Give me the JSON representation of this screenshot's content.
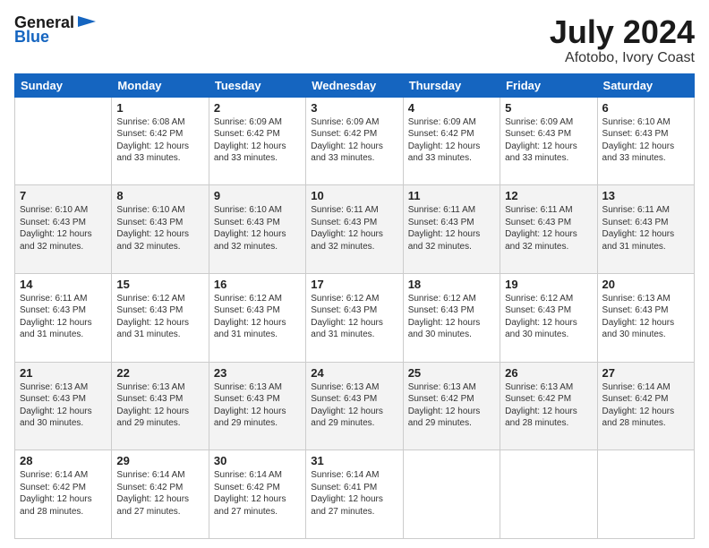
{
  "header": {
    "logo_general": "General",
    "logo_blue": "Blue",
    "month": "July 2024",
    "location": "Afotobo, Ivory Coast"
  },
  "weekdays": [
    "Sunday",
    "Monday",
    "Tuesday",
    "Wednesday",
    "Thursday",
    "Friday",
    "Saturday"
  ],
  "weeks": [
    [
      {
        "day": "",
        "info": ""
      },
      {
        "day": "1",
        "info": "Sunrise: 6:08 AM\nSunset: 6:42 PM\nDaylight: 12 hours\nand 33 minutes."
      },
      {
        "day": "2",
        "info": "Sunrise: 6:09 AM\nSunset: 6:42 PM\nDaylight: 12 hours\nand 33 minutes."
      },
      {
        "day": "3",
        "info": "Sunrise: 6:09 AM\nSunset: 6:42 PM\nDaylight: 12 hours\nand 33 minutes."
      },
      {
        "day": "4",
        "info": "Sunrise: 6:09 AM\nSunset: 6:42 PM\nDaylight: 12 hours\nand 33 minutes."
      },
      {
        "day": "5",
        "info": "Sunrise: 6:09 AM\nSunset: 6:43 PM\nDaylight: 12 hours\nand 33 minutes."
      },
      {
        "day": "6",
        "info": "Sunrise: 6:10 AM\nSunset: 6:43 PM\nDaylight: 12 hours\nand 33 minutes."
      }
    ],
    [
      {
        "day": "7",
        "info": "Sunrise: 6:10 AM\nSunset: 6:43 PM\nDaylight: 12 hours\nand 32 minutes."
      },
      {
        "day": "8",
        "info": "Sunrise: 6:10 AM\nSunset: 6:43 PM\nDaylight: 12 hours\nand 32 minutes."
      },
      {
        "day": "9",
        "info": "Sunrise: 6:10 AM\nSunset: 6:43 PM\nDaylight: 12 hours\nand 32 minutes."
      },
      {
        "day": "10",
        "info": "Sunrise: 6:11 AM\nSunset: 6:43 PM\nDaylight: 12 hours\nand 32 minutes."
      },
      {
        "day": "11",
        "info": "Sunrise: 6:11 AM\nSunset: 6:43 PM\nDaylight: 12 hours\nand 32 minutes."
      },
      {
        "day": "12",
        "info": "Sunrise: 6:11 AM\nSunset: 6:43 PM\nDaylight: 12 hours\nand 32 minutes."
      },
      {
        "day": "13",
        "info": "Sunrise: 6:11 AM\nSunset: 6:43 PM\nDaylight: 12 hours\nand 31 minutes."
      }
    ],
    [
      {
        "day": "14",
        "info": "Sunrise: 6:11 AM\nSunset: 6:43 PM\nDaylight: 12 hours\nand 31 minutes."
      },
      {
        "day": "15",
        "info": "Sunrise: 6:12 AM\nSunset: 6:43 PM\nDaylight: 12 hours\nand 31 minutes."
      },
      {
        "day": "16",
        "info": "Sunrise: 6:12 AM\nSunset: 6:43 PM\nDaylight: 12 hours\nand 31 minutes."
      },
      {
        "day": "17",
        "info": "Sunrise: 6:12 AM\nSunset: 6:43 PM\nDaylight: 12 hours\nand 31 minutes."
      },
      {
        "day": "18",
        "info": "Sunrise: 6:12 AM\nSunset: 6:43 PM\nDaylight: 12 hours\nand 30 minutes."
      },
      {
        "day": "19",
        "info": "Sunrise: 6:12 AM\nSunset: 6:43 PM\nDaylight: 12 hours\nand 30 minutes."
      },
      {
        "day": "20",
        "info": "Sunrise: 6:13 AM\nSunset: 6:43 PM\nDaylight: 12 hours\nand 30 minutes."
      }
    ],
    [
      {
        "day": "21",
        "info": "Sunrise: 6:13 AM\nSunset: 6:43 PM\nDaylight: 12 hours\nand 30 minutes."
      },
      {
        "day": "22",
        "info": "Sunrise: 6:13 AM\nSunset: 6:43 PM\nDaylight: 12 hours\nand 29 minutes."
      },
      {
        "day": "23",
        "info": "Sunrise: 6:13 AM\nSunset: 6:43 PM\nDaylight: 12 hours\nand 29 minutes."
      },
      {
        "day": "24",
        "info": "Sunrise: 6:13 AM\nSunset: 6:43 PM\nDaylight: 12 hours\nand 29 minutes."
      },
      {
        "day": "25",
        "info": "Sunrise: 6:13 AM\nSunset: 6:42 PM\nDaylight: 12 hours\nand 29 minutes."
      },
      {
        "day": "26",
        "info": "Sunrise: 6:13 AM\nSunset: 6:42 PM\nDaylight: 12 hours\nand 28 minutes."
      },
      {
        "day": "27",
        "info": "Sunrise: 6:14 AM\nSunset: 6:42 PM\nDaylight: 12 hours\nand 28 minutes."
      }
    ],
    [
      {
        "day": "28",
        "info": "Sunrise: 6:14 AM\nSunset: 6:42 PM\nDaylight: 12 hours\nand 28 minutes."
      },
      {
        "day": "29",
        "info": "Sunrise: 6:14 AM\nSunset: 6:42 PM\nDaylight: 12 hours\nand 27 minutes."
      },
      {
        "day": "30",
        "info": "Sunrise: 6:14 AM\nSunset: 6:42 PM\nDaylight: 12 hours\nand 27 minutes."
      },
      {
        "day": "31",
        "info": "Sunrise: 6:14 AM\nSunset: 6:41 PM\nDaylight: 12 hours\nand 27 minutes."
      },
      {
        "day": "",
        "info": ""
      },
      {
        "day": "",
        "info": ""
      },
      {
        "day": "",
        "info": ""
      }
    ]
  ]
}
